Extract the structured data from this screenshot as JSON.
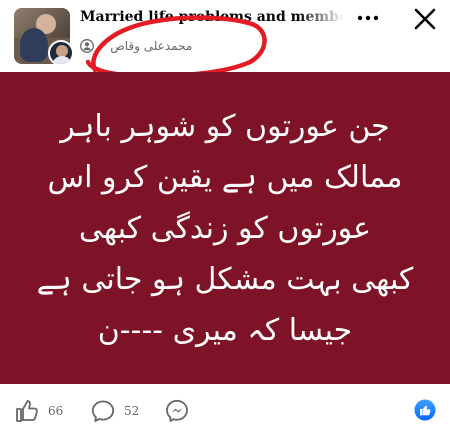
{
  "post": {
    "group_name": "Married life problems and membe...",
    "author": "محمدعلی وقاص",
    "separator": "·",
    "text_lines": [
      "جن عورتوں کو شوہر باہر",
      "ممالک میں ہے یقین کرو اس",
      "عورتوں کو زندگی کبھی",
      "کبھی بہت مشکل ہو جاتی ہے",
      "جیسا کہ میری ----ن"
    ],
    "background_color": "#7e1327"
  },
  "actions": {
    "like_count": "66",
    "comment_count": "52"
  },
  "icons": {
    "members": "members-icon",
    "more": "more-options-icon",
    "close": "close-icon",
    "like": "thumbs-up-icon",
    "comment": "comment-bubble-icon",
    "share": "messenger-icon",
    "reaction": "like-reaction-icon"
  },
  "annotation": {
    "color": "#e31b23"
  }
}
